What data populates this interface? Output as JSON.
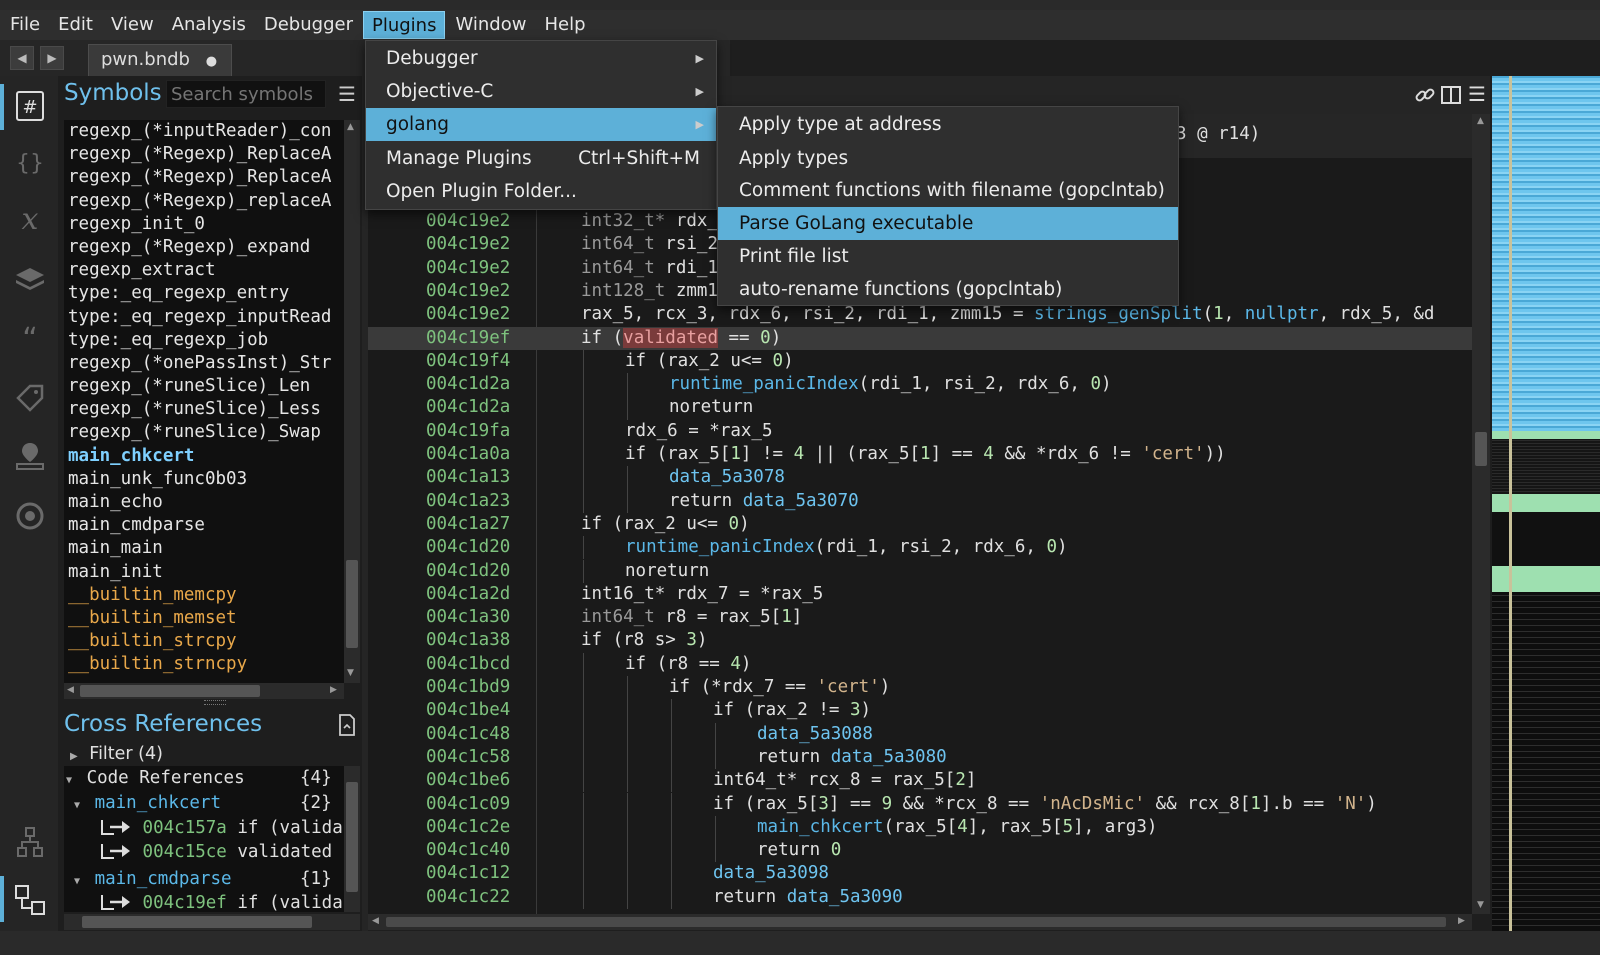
{
  "menubar": {
    "items": [
      "File",
      "Edit",
      "View",
      "Analysis",
      "Debugger",
      "Plugins",
      "Window",
      "Help"
    ],
    "active_index": 5
  },
  "tabbar": {
    "back_glyph": "◀",
    "forward_glyph": "▶",
    "tab_label": "pwn.bndb",
    "unsaved_dot": "●"
  },
  "icons": {
    "activity": [
      "symbols-hash-icon",
      "types-braces-icon",
      "variables-x-icon",
      "layers-icon",
      "strings-quote-icon",
      "tags-icon",
      "bookmarks-icon",
      "target-icon",
      "hierarchy-icon",
      "cross-ref-icon"
    ],
    "code_header": [
      "link-icon",
      "split-view-icon",
      "hamburger-menu-icon"
    ]
  },
  "symbols": {
    "title": "Symbols",
    "search_placeholder": "Search symbols",
    "items": [
      {
        "name": "regexp_(*inputReader)_con",
        "kind": "normal"
      },
      {
        "name": "regexp_(*Regexp)_ReplaceA",
        "kind": "normal"
      },
      {
        "name": "regexp_(*Regexp)_ReplaceA",
        "kind": "normal"
      },
      {
        "name": "regexp_(*Regexp)_replaceA",
        "kind": "normal"
      },
      {
        "name": "regexp_init_0",
        "kind": "normal"
      },
      {
        "name": "regexp_(*Regexp)_expand",
        "kind": "normal"
      },
      {
        "name": "regexp_extract",
        "kind": "normal"
      },
      {
        "name": "type:_eq_regexp_entry",
        "kind": "normal"
      },
      {
        "name": "type:_eq_regexp_inputRead",
        "kind": "normal"
      },
      {
        "name": "type:_eq_regexp_job",
        "kind": "normal"
      },
      {
        "name": "regexp_(*onePassInst)_Str",
        "kind": "normal"
      },
      {
        "name": "regexp_(*runeSlice)_Len",
        "kind": "normal"
      },
      {
        "name": "regexp_(*runeSlice)_Less",
        "kind": "normal"
      },
      {
        "name": "regexp_(*runeSlice)_Swap",
        "kind": "normal"
      },
      {
        "name": "main_chkcert",
        "kind": "current"
      },
      {
        "name": "main_unk_func0b03",
        "kind": "normal"
      },
      {
        "name": "main_echo",
        "kind": "normal"
      },
      {
        "name": "main_cmdparse",
        "kind": "normal"
      },
      {
        "name": "main_main",
        "kind": "normal"
      },
      {
        "name": "main_init",
        "kind": "normal"
      },
      {
        "name": "__builtin_memcpy",
        "kind": "builtin"
      },
      {
        "name": "__builtin_memset",
        "kind": "builtin"
      },
      {
        "name": "__builtin_strcpy",
        "kind": "builtin"
      },
      {
        "name": "__builtin_strncpy",
        "kind": "builtin"
      }
    ]
  },
  "xrefs": {
    "title": "Cross References",
    "filter_label": "Filter (4)",
    "code_refs_label": "Code References",
    "code_refs_count": "{4}",
    "groups": [
      {
        "name": "main_chkcert",
        "count": "{2}",
        "refs": [
          {
            "addr": "004c157a",
            "text": "if (valida"
          },
          {
            "addr": "004c15ce",
            "text": "validated"
          }
        ]
      },
      {
        "name": "main_cmdparse",
        "count": "{1}",
        "refs": [
          {
            "addr": "004c19ef",
            "text": "if (valida"
          }
        ]
      }
    ]
  },
  "code": {
    "signature_tail": "3 @ r14)",
    "lines": [
      {
        "addr": "004c19e2",
        "indent": 0,
        "parts": [
          [
            "t",
            "int32_t* "
          ],
          [
            "p",
            "rdx_"
          ]
        ]
      },
      {
        "addr": "004c19e2",
        "indent": 0,
        "parts": [
          [
            "t",
            "int64_t "
          ],
          [
            "p",
            "rsi_2"
          ]
        ]
      },
      {
        "addr": "004c19e2",
        "indent": 0,
        "parts": [
          [
            "t",
            "int64_t "
          ],
          [
            "p",
            "rdi_1"
          ]
        ]
      },
      {
        "addr": "004c19e2",
        "indent": 0,
        "parts": [
          [
            "t",
            "int128_t "
          ],
          [
            "p",
            "zmm1"
          ]
        ]
      },
      {
        "addr": "004c19e2",
        "indent": 0,
        "parts": [
          [
            "p",
            "rax_5, rcx_3, rdx_6, rsi_2, rdi_1, zmm15 = "
          ],
          [
            "f",
            "strings_genSplit"
          ],
          [
            "p",
            "("
          ],
          [
            "n",
            "1"
          ],
          [
            "p",
            ", "
          ],
          [
            "f",
            "nullptr"
          ],
          [
            "p",
            ", rdx_5, &d"
          ]
        ]
      },
      {
        "addr": "004c19ef",
        "indent": 0,
        "hl": true,
        "parts": [
          [
            "p",
            "if ("
          ],
          [
            "v",
            "validated"
          ],
          [
            "p",
            " == "
          ],
          [
            "n",
            "0"
          ],
          [
            "p",
            ")"
          ]
        ]
      },
      {
        "addr": "004c19f4",
        "indent": 1,
        "parts": [
          [
            "p",
            "if (rax_2 u<= "
          ],
          [
            "n",
            "0"
          ],
          [
            "p",
            ")"
          ]
        ]
      },
      {
        "addr": "004c1d2a",
        "indent": 2,
        "parts": [
          [
            "f",
            "runtime_panicIndex"
          ],
          [
            "p",
            "(rdi_1, rsi_2, rdx_6, "
          ],
          [
            "n",
            "0"
          ],
          [
            "p",
            ")"
          ]
        ]
      },
      {
        "addr": "004c1d2a",
        "indent": 2,
        "parts": [
          [
            "p",
            "noreturn"
          ]
        ]
      },
      {
        "addr": "004c19fa",
        "indent": 1,
        "parts": [
          [
            "p",
            "rdx_6 = *rax_5"
          ]
        ]
      },
      {
        "addr": "004c1a0a",
        "indent": 1,
        "parts": [
          [
            "p",
            "if (rax_5["
          ],
          [
            "n",
            "1"
          ],
          [
            "p",
            "] != "
          ],
          [
            "n",
            "4"
          ],
          [
            "p",
            " || (rax_5["
          ],
          [
            "n",
            "1"
          ],
          [
            "p",
            "] == "
          ],
          [
            "n",
            "4"
          ],
          [
            "p",
            " && *rdx_6 != "
          ],
          [
            "s",
            "'cert'"
          ],
          [
            "p",
            "))"
          ]
        ]
      },
      {
        "addr": "004c1a13",
        "indent": 2,
        "parts": [
          [
            "d",
            "data_5a3078"
          ]
        ]
      },
      {
        "addr": "004c1a23",
        "indent": 2,
        "parts": [
          [
            "p",
            "return "
          ],
          [
            "d",
            "data_5a3070"
          ]
        ]
      },
      {
        "addr": "004c1a27",
        "indent": 0,
        "parts": [
          [
            "p",
            "if (rax_2 u<= "
          ],
          [
            "n",
            "0"
          ],
          [
            "p",
            ")"
          ]
        ]
      },
      {
        "addr": "004c1d20",
        "indent": 1,
        "parts": [
          [
            "f",
            "runtime_panicIndex"
          ],
          [
            "p",
            "(rdi_1, rsi_2, rdx_6, "
          ],
          [
            "n",
            "0"
          ],
          [
            "p",
            ")"
          ]
        ]
      },
      {
        "addr": "004c1d20",
        "indent": 1,
        "parts": [
          [
            "p",
            "noreturn"
          ]
        ]
      },
      {
        "addr": "004c1a2d",
        "indent": 0,
        "parts": [
          [
            "p",
            "int16_t* rdx_7 = *rax_5"
          ]
        ]
      },
      {
        "addr": "004c1a30",
        "indent": 0,
        "parts": [
          [
            "t",
            "int64_t "
          ],
          [
            "p",
            "r8 = rax_5["
          ],
          [
            "n",
            "1"
          ],
          [
            "p",
            "]"
          ]
        ]
      },
      {
        "addr": "004c1a38",
        "indent": 0,
        "parts": [
          [
            "p",
            "if (r8 s> "
          ],
          [
            "n",
            "3"
          ],
          [
            "p",
            ")"
          ]
        ]
      },
      {
        "addr": "004c1bcd",
        "indent": 1,
        "parts": [
          [
            "p",
            "if (r8 == "
          ],
          [
            "n",
            "4"
          ],
          [
            "p",
            ")"
          ]
        ]
      },
      {
        "addr": "004c1bd9",
        "indent": 2,
        "parts": [
          [
            "p",
            "if (*rdx_7 == "
          ],
          [
            "s",
            "'cert'"
          ],
          [
            "p",
            ")"
          ]
        ]
      },
      {
        "addr": "004c1be4",
        "indent": 3,
        "parts": [
          [
            "p",
            "if (rax_2 != "
          ],
          [
            "n",
            "3"
          ],
          [
            "p",
            ")"
          ]
        ]
      },
      {
        "addr": "004c1c48",
        "indent": 4,
        "parts": [
          [
            "d",
            "data_5a3088"
          ]
        ]
      },
      {
        "addr": "004c1c58",
        "indent": 4,
        "parts": [
          [
            "p",
            "return "
          ],
          [
            "d",
            "data_5a3080"
          ]
        ]
      },
      {
        "addr": "004c1be6",
        "indent": 3,
        "parts": [
          [
            "p",
            "int64_t* rcx_8 = rax_5["
          ],
          [
            "n",
            "2"
          ],
          [
            "p",
            "]"
          ]
        ]
      },
      {
        "addr": "004c1c09",
        "indent": 3,
        "parts": [
          [
            "p",
            "if (rax_5["
          ],
          [
            "n",
            "3"
          ],
          [
            "p",
            "] == "
          ],
          [
            "n",
            "9"
          ],
          [
            "p",
            " && *rcx_8 == "
          ],
          [
            "s",
            "'nAcDsMic'"
          ],
          [
            "p",
            " && rcx_8["
          ],
          [
            "n",
            "1"
          ],
          [
            "p",
            "].b == "
          ],
          [
            "s",
            "'N'"
          ],
          [
            "p",
            ")"
          ]
        ]
      },
      {
        "addr": "004c1c2e",
        "indent": 4,
        "parts": [
          [
            "f",
            "main_chkcert"
          ],
          [
            "p",
            "(rax_5["
          ],
          [
            "n",
            "4"
          ],
          [
            "p",
            "], rax_5["
          ],
          [
            "n",
            "5"
          ],
          [
            "p",
            "], arg3)"
          ]
        ]
      },
      {
        "addr": "004c1c40",
        "indent": 4,
        "parts": [
          [
            "p",
            "return "
          ],
          [
            "n",
            "0"
          ]
        ]
      },
      {
        "addr": "004c1c12",
        "indent": 3,
        "parts": [
          [
            "d",
            "data_5a3098"
          ]
        ]
      },
      {
        "addr": "004c1c22",
        "indent": 3,
        "parts": [
          [
            "p",
            "return "
          ],
          [
            "d",
            "data_5a3090"
          ]
        ]
      }
    ]
  },
  "plugins_menu": {
    "items": [
      {
        "label": "Debugger",
        "submenu": true
      },
      {
        "label": "Objective-C",
        "submenu": true
      },
      {
        "label": "golang",
        "submenu": true,
        "selected": true
      },
      {
        "label": "Manage Plugins",
        "shortcut": "Ctrl+Shift+M"
      },
      {
        "label": "Open Plugin Folder..."
      }
    ]
  },
  "golang_menu": {
    "items": [
      {
        "label": "Apply type at address"
      },
      {
        "label": "Apply types"
      },
      {
        "label": "Comment functions with filename (gopclntab)"
      },
      {
        "label": "Parse GoLang executable",
        "selected": true
      },
      {
        "label": "Print file list"
      },
      {
        "label": "auto-rename functions (gopclntab)"
      }
    ]
  },
  "colors": {
    "accent_blue": "#5db0d8",
    "address_green": "#7ec27e",
    "function_blue": "#5bb8e8",
    "data_blue": "#6ec4f0",
    "type_gray": "#9a9a9a",
    "number": "#b8e6b0",
    "string": "#d2b48c",
    "symbol_builtin": "#e9a84a",
    "highlight_var_bg": "#7a3b3b"
  }
}
